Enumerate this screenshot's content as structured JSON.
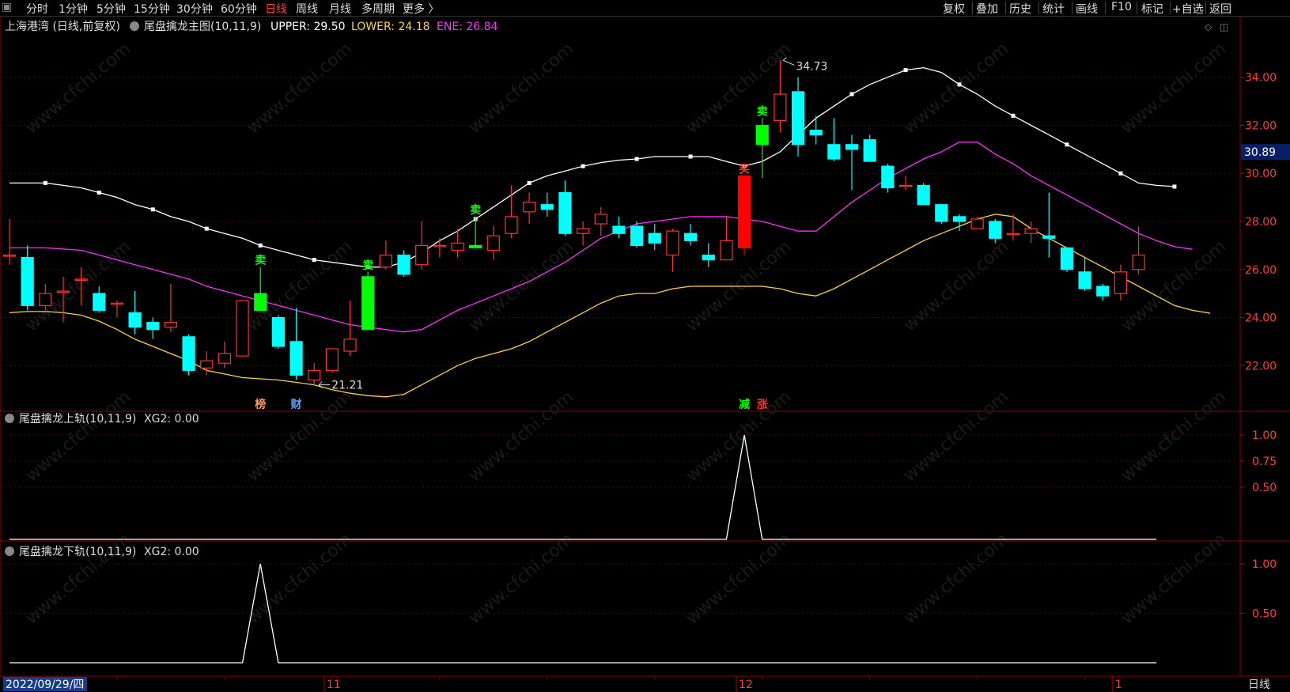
{
  "toolbar": {
    "left_tabs": [
      "分时",
      "1分钟",
      "5分钟",
      "15分钟",
      "30分钟",
      "60分钟",
      "日线",
      "周线",
      "月线",
      "多周期",
      "更多 〉"
    ],
    "active_tab": "日线",
    "right_tabs": [
      "复权",
      "叠加",
      "历史",
      "统计",
      "画线",
      "F10",
      "标记",
      "+自选",
      "返回"
    ]
  },
  "main_panel": {
    "symbol_label": "上海港湾 (日线,前复权)",
    "indicator_name": "尾盘擒龙主图(10,11,9)",
    "upper_label": "UPPER: 29.50",
    "lower_label": "LOWER: 24.18",
    "ene_label": "ENE: 26.84",
    "colors": {
      "upper": "#ffffff",
      "lower": "#ffd23c",
      "ene": "#ff2eff"
    }
  },
  "sub_panel_1": {
    "title": "尾盘擒龙上轨(10,11,9)",
    "value_label": "XG2: 0.00"
  },
  "sub_panel_2": {
    "title": "尾盘擒龙下轨(10,11,9)",
    "value_label": "XG2: 0.00"
  },
  "bottom_bar": {
    "date_label": "2022/09/29/四",
    "period_label": "日线",
    "month_labels": [
      "11",
      "12",
      "1"
    ]
  },
  "watermark": "www.cfchi.com",
  "chart_data": [
    {
      "type": "candlestick",
      "title": "尾盘擒龙主图(10,11,9)",
      "ylim": [
        20.1,
        35.9
      ],
      "yticks": [
        22,
        24,
        26,
        28,
        30,
        32,
        34
      ],
      "ytick_labels": [
        "22.00",
        "24.00",
        "26.00",
        "28.00",
        "30.00",
        "32.00",
        "34.00"
      ],
      "current_price_label": "30.89",
      "current_price": 30.89,
      "high_label": "34.73",
      "low_label": "21.21",
      "candles": [
        {
          "o": 26.6,
          "h": 28.1,
          "l": 26.2,
          "c": 26.6
        },
        {
          "o": 26.5,
          "h": 27.0,
          "l": 24.3,
          "c": 24.5
        },
        {
          "o": 24.5,
          "h": 25.4,
          "l": 24.3,
          "c": 25.0
        },
        {
          "o": 25.1,
          "h": 25.7,
          "l": 23.8,
          "c": 25.1
        },
        {
          "o": 25.6,
          "h": 26.1,
          "l": 24.5,
          "c": 25.6
        },
        {
          "o": 25.0,
          "h": 25.3,
          "l": 24.2,
          "c": 24.3
        },
        {
          "o": 24.6,
          "h": 24.7,
          "l": 24.0,
          "c": 24.6
        },
        {
          "o": 24.2,
          "h": 25.1,
          "l": 23.3,
          "c": 23.6
        },
        {
          "o": 23.8,
          "h": 24.0,
          "l": 23.1,
          "c": 23.5
        },
        {
          "o": 23.6,
          "h": 25.4,
          "l": 23.4,
          "c": 23.8
        },
        {
          "o": 23.2,
          "h": 23.3,
          "l": 21.6,
          "c": 21.8
        },
        {
          "o": 21.9,
          "h": 22.6,
          "l": 21.6,
          "c": 22.2
        },
        {
          "o": 22.1,
          "h": 23.0,
          "l": 21.9,
          "c": 22.5
        },
        {
          "o": 22.4,
          "h": 24.7,
          "l": 22.4,
          "c": 24.7
        },
        {
          "o": 24.3,
          "h": 26.1,
          "l": 24.3,
          "c": 25.0
        },
        {
          "o": 24.0,
          "h": 24.1,
          "l": 22.7,
          "c": 22.8
        },
        {
          "o": 23.0,
          "h": 24.4,
          "l": 21.4,
          "c": 21.6
        },
        {
          "o": 21.4,
          "h": 22.1,
          "l": 21.2,
          "c": 21.8
        },
        {
          "o": 21.8,
          "h": 22.7,
          "l": 21.7,
          "c": 22.7
        },
        {
          "o": 22.6,
          "h": 24.7,
          "l": 22.4,
          "c": 23.1
        },
        {
          "o": 25.7,
          "h": 25.9,
          "l": 25.6,
          "c": 23.5
        },
        {
          "o": 26.1,
          "h": 27.2,
          "l": 26.0,
          "c": 26.6
        },
        {
          "o": 26.6,
          "h": 26.8,
          "l": 25.7,
          "c": 25.8
        },
        {
          "o": 26.2,
          "h": 28.0,
          "l": 26.0,
          "c": 27.0
        },
        {
          "o": 27.0,
          "h": 27.3,
          "l": 26.5,
          "c": 27.0
        },
        {
          "o": 26.8,
          "h": 27.7,
          "l": 26.5,
          "c": 27.1
        },
        {
          "o": 27.0,
          "h": 28.2,
          "l": 26.9,
          "c": 26.9
        },
        {
          "o": 26.8,
          "h": 27.8,
          "l": 26.4,
          "c": 27.4
        },
        {
          "o": 27.5,
          "h": 29.5,
          "l": 27.3,
          "c": 28.2
        },
        {
          "o": 28.4,
          "h": 29.2,
          "l": 27.9,
          "c": 28.8
        },
        {
          "o": 28.7,
          "h": 29.2,
          "l": 28.2,
          "c": 28.5
        },
        {
          "o": 29.2,
          "h": 29.7,
          "l": 27.4,
          "c": 27.5
        },
        {
          "o": 27.5,
          "h": 28.0,
          "l": 27.0,
          "c": 27.7
        },
        {
          "o": 27.9,
          "h": 28.6,
          "l": 27.4,
          "c": 28.3
        },
        {
          "o": 27.8,
          "h": 28.2,
          "l": 27.3,
          "c": 27.5
        },
        {
          "o": 27.8,
          "h": 28.0,
          "l": 26.9,
          "c": 27.0
        },
        {
          "o": 27.5,
          "h": 27.9,
          "l": 26.8,
          "c": 27.1
        },
        {
          "o": 26.6,
          "h": 27.7,
          "l": 25.9,
          "c": 27.6
        },
        {
          "o": 27.5,
          "h": 27.9,
          "l": 27.0,
          "c": 27.2
        },
        {
          "o": 26.6,
          "h": 27.1,
          "l": 26.1,
          "c": 26.4
        },
        {
          "o": 26.4,
          "h": 28.2,
          "l": 26.4,
          "c": 27.2
        },
        {
          "o": 29.9,
          "h": 29.9,
          "l": 26.6,
          "c": 26.9
        },
        {
          "o": 31.2,
          "h": 32.3,
          "l": 29.8,
          "c": 32.0
        },
        {
          "o": 32.2,
          "h": 34.7,
          "l": 31.7,
          "c": 33.3
        },
        {
          "o": 33.4,
          "h": 34.0,
          "l": 30.7,
          "c": 31.2
        },
        {
          "o": 31.8,
          "h": 32.4,
          "l": 31.2,
          "c": 31.6
        },
        {
          "o": 31.2,
          "h": 32.3,
          "l": 30.5,
          "c": 30.6
        },
        {
          "o": 31.2,
          "h": 31.6,
          "l": 29.3,
          "c": 31.0
        },
        {
          "o": 31.4,
          "h": 31.6,
          "l": 30.5,
          "c": 30.5
        },
        {
          "o": 30.3,
          "h": 30.4,
          "l": 29.2,
          "c": 29.4
        },
        {
          "o": 29.5,
          "h": 29.9,
          "l": 29.3,
          "c": 29.5
        },
        {
          "o": 29.5,
          "h": 29.6,
          "l": 28.7,
          "c": 28.7
        },
        {
          "o": 28.7,
          "h": 28.7,
          "l": 27.9,
          "c": 28.0
        },
        {
          "o": 28.2,
          "h": 28.3,
          "l": 27.6,
          "c": 28.0
        },
        {
          "o": 27.7,
          "h": 28.2,
          "l": 27.7,
          "c": 28.1
        },
        {
          "o": 28.0,
          "h": 28.1,
          "l": 27.1,
          "c": 27.3
        },
        {
          "o": 27.5,
          "h": 28.3,
          "l": 27.2,
          "c": 27.5
        },
        {
          "o": 27.5,
          "h": 28.0,
          "l": 27.1,
          "c": 27.7
        },
        {
          "o": 27.4,
          "h": 29.2,
          "l": 26.5,
          "c": 27.3
        },
        {
          "o": 26.9,
          "h": 26.9,
          "l": 25.9,
          "c": 26.0
        },
        {
          "o": 25.9,
          "h": 26.5,
          "l": 25.1,
          "c": 25.2
        },
        {
          "o": 25.3,
          "h": 25.4,
          "l": 24.7,
          "c": 24.9
        },
        {
          "o": 25.0,
          "h": 26.2,
          "l": 24.7,
          "c": 25.9
        },
        {
          "o": 26.0,
          "h": 27.8,
          "l": 25.8,
          "c": 26.6
        }
      ],
      "candle_colors": {
        "up": "#ff3030",
        "down": "#00ffff",
        "signal_down": "#00ff00",
        "limit_up": "#ff0000"
      },
      "special_candles": [
        {
          "index": 14,
          "color": "#00ff00"
        },
        {
          "index": 20,
          "color": "#00ff00"
        },
        {
          "index": 26,
          "color": "#00ff00"
        },
        {
          "index": 41,
          "color": "#ff0000"
        },
        {
          "index": 42,
          "color": "#00ff00"
        }
      ],
      "series": [
        {
          "name": "UPPER",
          "color": "#ffffff",
          "values": [
            29.6,
            29.6,
            29.6,
            29.5,
            29.4,
            29.2,
            29.0,
            28.7,
            28.5,
            28.2,
            28.0,
            27.7,
            27.5,
            27.3,
            27.0,
            26.8,
            26.6,
            26.4,
            26.3,
            26.2,
            26.1,
            26.1,
            26.3,
            26.7,
            27.2,
            27.6,
            28.1,
            28.6,
            29.1,
            29.6,
            29.9,
            30.1,
            30.3,
            30.45,
            30.55,
            30.6,
            30.7,
            30.7,
            30.7,
            30.7,
            30.5,
            30.3,
            30.5,
            30.9,
            31.6,
            32.3,
            32.8,
            33.3,
            33.7,
            34.0,
            34.3,
            34.4,
            34.2,
            33.7,
            33.3,
            32.8,
            32.4,
            32.0,
            31.6,
            31.2,
            30.8,
            30.4,
            30.0,
            29.6,
            29.5,
            29.45
          ]
        },
        {
          "name": "ENE",
          "color": "#ff2eff",
          "values": [
            26.9,
            26.9,
            26.9,
            26.85,
            26.8,
            26.6,
            26.4,
            26.2,
            26.0,
            25.8,
            25.6,
            25.3,
            25.1,
            24.9,
            24.7,
            24.5,
            24.3,
            24.1,
            23.9,
            23.7,
            23.6,
            23.5,
            23.4,
            23.5,
            23.9,
            24.3,
            24.6,
            24.9,
            25.2,
            25.5,
            25.9,
            26.3,
            26.8,
            27.3,
            27.6,
            27.9,
            28.0,
            28.1,
            28.2,
            28.2,
            28.2,
            28.1,
            28.0,
            27.8,
            27.6,
            27.6,
            28.2,
            28.8,
            29.3,
            29.8,
            30.2,
            30.6,
            30.9,
            31.3,
            31.3,
            30.8,
            30.4,
            29.9,
            29.5,
            29.1,
            28.7,
            28.3,
            27.9,
            27.5,
            27.2,
            26.95,
            26.84
          ]
        },
        {
          "name": "LOWER",
          "color": "#ffd23c",
          "values": [
            24.2,
            24.25,
            24.25,
            24.2,
            24.1,
            23.85,
            23.5,
            23.1,
            22.8,
            22.5,
            22.2,
            21.8,
            21.65,
            21.5,
            21.45,
            21.4,
            21.3,
            21.2,
            21.0,
            20.85,
            20.75,
            20.7,
            20.8,
            21.2,
            21.6,
            22.0,
            22.3,
            22.5,
            22.7,
            23.0,
            23.4,
            23.8,
            24.2,
            24.6,
            24.9,
            25.0,
            25.0,
            25.2,
            25.3,
            25.3,
            25.3,
            25.3,
            25.3,
            25.2,
            25.0,
            24.9,
            25.2,
            25.6,
            26.0,
            26.4,
            26.8,
            27.2,
            27.5,
            27.8,
            28.1,
            28.3,
            28.2,
            27.7,
            27.3,
            26.9,
            26.5,
            26.1,
            25.7,
            25.3,
            24.9,
            24.5,
            24.3,
            24.18
          ]
        }
      ],
      "signals": [
        {
          "index": 14,
          "text": "卖",
          "color": "#00ff00"
        },
        {
          "index": 20,
          "text": "卖",
          "color": "#00ff00"
        },
        {
          "index": 26,
          "text": "卖",
          "color": "#00ff00"
        },
        {
          "index": 42,
          "text": "卖",
          "color": "#00ff00"
        },
        {
          "index": 41,
          "text": "买",
          "color": "#ff3030"
        }
      ],
      "event_tags": [
        {
          "index": 14,
          "text": "榜",
          "color": "#ff9a5a"
        },
        {
          "index": 16,
          "text": "财",
          "color": "#66a3ff"
        },
        {
          "index": 41,
          "text": "减",
          "color": "#00ff00"
        },
        {
          "index": 42,
          "text": "涨",
          "color": "#ff3030"
        }
      ]
    },
    {
      "type": "line",
      "title": "尾盘擒龙上轨(10,11,9)",
      "ylim": [
        0,
        1
      ],
      "yticks": [
        0.5,
        0.75,
        1.0
      ],
      "ytick_labels": [
        "0.50",
        "0.75",
        "1.00"
      ],
      "series": [
        {
          "name": "XG2",
          "color": "#ffffff",
          "values": [
            0,
            0,
            0,
            0,
            0,
            0,
            0,
            0,
            0,
            0,
            0,
            0,
            0,
            0,
            0,
            0,
            0,
            0,
            0,
            0,
            0,
            0,
            0,
            0,
            0,
            0,
            0,
            0,
            0,
            0,
            0,
            0,
            0,
            0,
            0,
            0,
            0,
            0,
            0,
            0,
            0,
            1,
            0,
            0,
            0,
            0,
            0,
            0,
            0,
            0,
            0,
            0,
            0,
            0,
            0,
            0,
            0,
            0,
            0,
            0,
            0,
            0,
            0,
            0,
            0
          ]
        }
      ]
    },
    {
      "type": "line",
      "title": "尾盘擒龙下轨(10,11,9)",
      "ylim": [
        0,
        1
      ],
      "yticks": [
        0.5,
        1.0
      ],
      "ytick_labels": [
        "0.50",
        "1.00"
      ],
      "series": [
        {
          "name": "XG2",
          "color": "#ffffff",
          "values": [
            0,
            0,
            0,
            0,
            0,
            0,
            0,
            0,
            0,
            0,
            0,
            0,
            0,
            0,
            1,
            0,
            0,
            0,
            0,
            0,
            0,
            0,
            0,
            0,
            0,
            0,
            0,
            0,
            0,
            0,
            0,
            0,
            0,
            0,
            0,
            0,
            0,
            0,
            0,
            0,
            0,
            0,
            0,
            0,
            0,
            0,
            0,
            0,
            0,
            0,
            0,
            0,
            0,
            0,
            0,
            0,
            0,
            0,
            0,
            0,
            0,
            0,
            0,
            0,
            0
          ]
        }
      ]
    }
  ]
}
